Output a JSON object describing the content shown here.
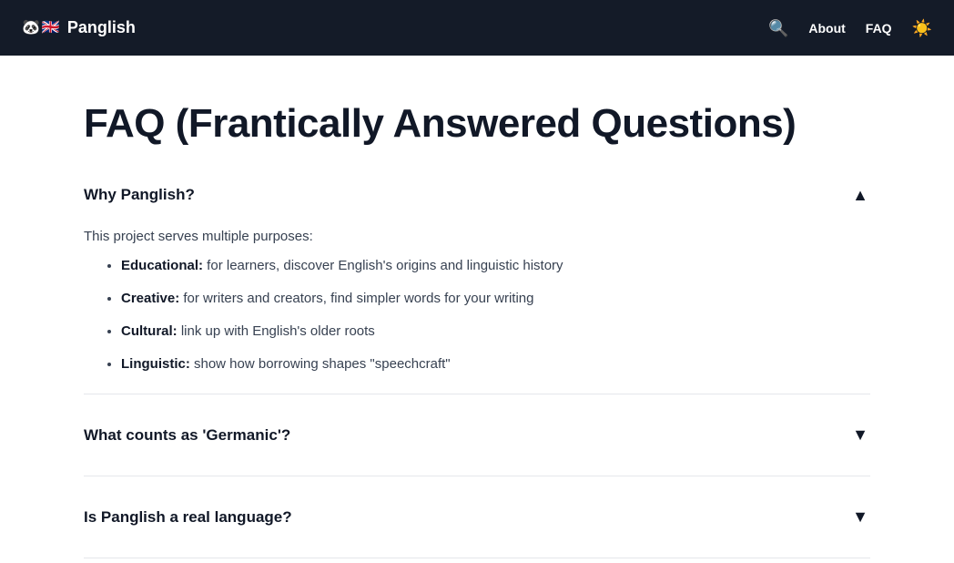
{
  "header": {
    "brand_panda": "🐼",
    "brand_flag": "🇬🇧",
    "brand_name": "Panglish",
    "search_icon": "🔍",
    "nav_about": "About",
    "nav_faq": "FAQ",
    "theme_icon": "☀️"
  },
  "page": {
    "title": "FAQ (Frantically Answered Questions)"
  },
  "faq": [
    {
      "question": "Why Panglish?",
      "chevron": "▲",
      "intro": "This project serves multiple purposes:",
      "points": [
        {
          "label": "Educational:",
          "text": " for learners, discover English's origins and linguistic history"
        },
        {
          "label": "Creative:",
          "text": " for writers and creators, find simpler words for your writing"
        },
        {
          "label": "Cultural:",
          "text": " link up with English's older roots"
        },
        {
          "label": "Linguistic:",
          "text": " show how borrowing shapes \"speechcraft\""
        }
      ]
    },
    {
      "question": "What counts as 'Germanic'?",
      "chevron": "▼"
    },
    {
      "question": "Is Panglish a real language?",
      "chevron": "▼"
    }
  ],
  "colors": {
    "topbar": "#141b28",
    "text": "#111827",
    "muted": "#374151",
    "divider": "#e5e7eb"
  }
}
